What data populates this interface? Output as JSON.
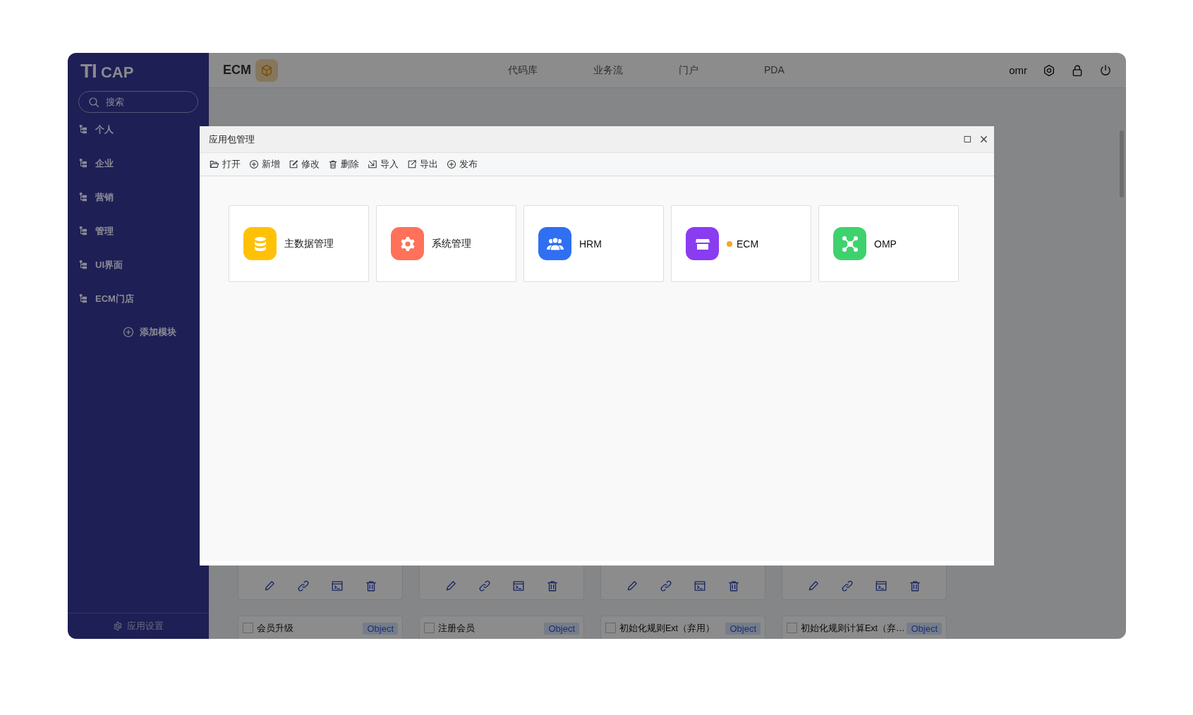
{
  "sidebar": {
    "logo": {
      "mark": "TI",
      "name": "CAP"
    },
    "search": {
      "placeholder": "搜索"
    },
    "items": [
      {
        "label": "个人"
      },
      {
        "label": "企业"
      },
      {
        "label": "营销"
      },
      {
        "label": "管理"
      },
      {
        "label": "UI界面"
      },
      {
        "label": "ECM门店"
      }
    ],
    "add_button": "添加模块",
    "footer": "应用设置"
  },
  "header": {
    "brand": "ECM",
    "nav": [
      "代码库",
      "业务流",
      "门户",
      "PDA"
    ],
    "user": "omr"
  },
  "background_cards": {
    "items": [
      {
        "name": "会员升级",
        "checked": false,
        "tag": "Object"
      },
      {
        "name": "注册会员",
        "checked": false,
        "tag": "Object"
      },
      {
        "name": "初始化规则Ext（弃用）",
        "checked": false,
        "tag": "Object"
      },
      {
        "name": "初始化规则计算Ext（弃…",
        "checked": false,
        "tag": "Object"
      }
    ]
  },
  "dialog": {
    "title": "应用包管理",
    "toolbar": [
      {
        "kind": "open",
        "label": "打开"
      },
      {
        "kind": "add",
        "label": "新增"
      },
      {
        "kind": "edit",
        "label": "修改"
      },
      {
        "kind": "delete",
        "label": "删除"
      },
      {
        "kind": "import",
        "label": "导入"
      },
      {
        "kind": "export",
        "label": "导出"
      },
      {
        "kind": "publish",
        "label": "发布"
      }
    ],
    "packages": [
      {
        "kind": "database",
        "name": "主数据管理",
        "color": "#ffc107",
        "dot": false
      },
      {
        "kind": "gear",
        "name": "系统管理",
        "color": "#ff7158",
        "dot": false
      },
      {
        "kind": "people",
        "name": "HRM",
        "color": "#2f6ff2",
        "dot": false
      },
      {
        "kind": "store",
        "name": "ECM",
        "color": "#8a3cf0",
        "dot": true
      },
      {
        "kind": "network",
        "name": "OMP",
        "color": "#3ed26e",
        "dot": false
      }
    ]
  }
}
